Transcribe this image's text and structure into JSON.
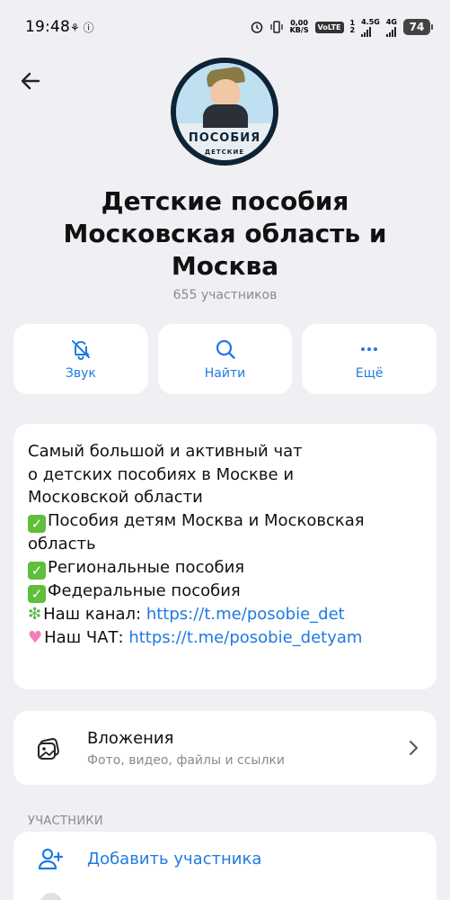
{
  "status_bar": {
    "time": "19:48",
    "left_icons": "⚘ ⓘ",
    "speed_value": "0,00",
    "speed_unit": "KB/S",
    "volte": "VoLTE",
    "sim1": "1",
    "sim2": "2",
    "net1": "4.5G",
    "net2": "4G",
    "battery": "74"
  },
  "header": {
    "title": "Детские пособия Московская область и Москва",
    "subtitle": "655 участников",
    "avatar_text": "ПОСОБИЯ",
    "avatar_subtext": "ДЕТСКИЕ"
  },
  "actions": [
    {
      "label": "Звук",
      "icon": "muted-bell-icon"
    },
    {
      "label": "Найти",
      "icon": "search-icon"
    },
    {
      "label": "Ещё",
      "icon": "more-dots-icon"
    }
  ],
  "description": {
    "line1": "Самый большой и активный чат",
    "line2": "о детских пособиях в Москве и",
    "line3": "Московской области",
    "line4": "Пособия детям Москва и Московская",
    "line5": "область",
    "line6": "Региональные пособия",
    "line7": "Федеральные пособия",
    "channel_prefix": "Наш канал: ",
    "channel_link": "https://t.me/posobie_det",
    "chat_prefix": "Наш ЧАТ: ",
    "chat_link": "https://t.me/posobie_detyam"
  },
  "attachments": {
    "title": "Вложения",
    "subtitle": "Фото, видео, файлы и ссылки"
  },
  "members": {
    "section_label": "УЧАСТНИКИ",
    "add_member_label": "Добавить участника"
  },
  "colors": {
    "accent": "#1f7ae0",
    "background": "#efeff4",
    "card": "#ffffff",
    "secondary_text": "#8a8a8e"
  }
}
